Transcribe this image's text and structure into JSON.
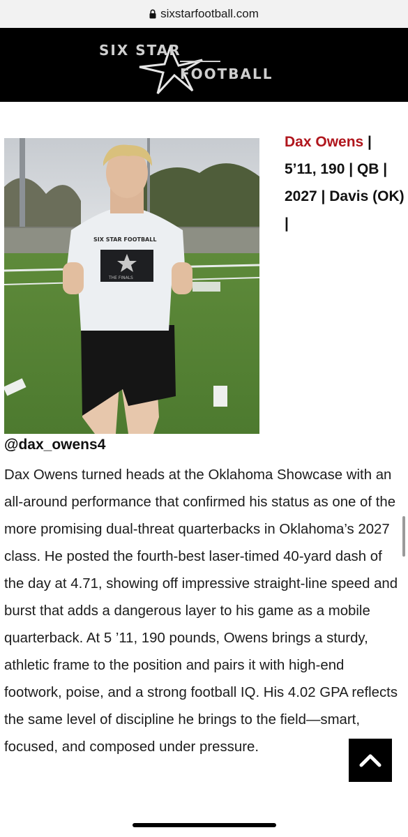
{
  "browser": {
    "url": "sixstarfootball.com"
  },
  "header": {
    "logo_top": "SIX STAR",
    "logo_bottom": "FOOTBALL"
  },
  "article": {
    "headline_name": "Dax Owens",
    "headline_rest": " | 5’11, 190 | QB | 2027 | Davis (OK) |",
    "handle": "@dax_owens4",
    "body": "Dax Owens turned heads at the Oklahoma Showcase with an all-around performance that confirmed his status as one of the more promising dual-threat quarterbacks in Oklahoma’s 2027 class. He posted the fourth-best laser-timed 40-yard dash of the day at 4.71, showing off impressive straight-line speed and burst that adds a dangerous layer to his game as a mobile quarterback. At 5 ’11, 190 pounds, Owens brings a sturdy, athletic frame to the position and pairs it with high-end footwork, poise, and a strong football IQ. His 4.02 GPA reflects the same level of discipline he brings to the field—smart, focused, and composed under pressure."
  },
  "photo": {
    "shirt_text": "SIX STAR FOOTBALL",
    "card_text": "THE FINALS"
  },
  "colors": {
    "accent": "#b0161d",
    "banner": "#000000"
  },
  "icons": {
    "lock": "lock-icon",
    "scroll_top": "chevron-up-icon"
  }
}
